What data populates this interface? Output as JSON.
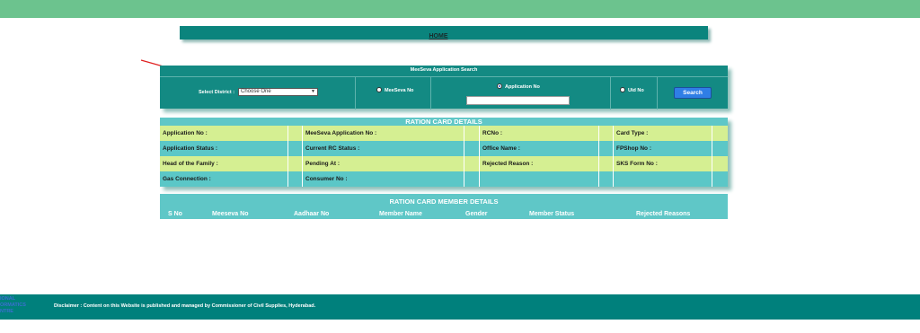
{
  "header": {
    "home_link": "HOME"
  },
  "search": {
    "title": "MeeSeva Application Search",
    "district_label": "Select District :",
    "district_selected": "Choose One",
    "options": [
      {
        "label": "MeeSeva No",
        "checked": false
      },
      {
        "label": "Application No",
        "checked": true
      },
      {
        "label": "Uid No",
        "checked": false
      }
    ],
    "search_button": "Search"
  },
  "ration_card": {
    "title": "RATION CARD DETAILS",
    "rows": [
      [
        "Application No :",
        "MeeSeva Application No :",
        "RCNo :",
        "Card Type :"
      ],
      [
        "Application Status :",
        "Current RC Status :",
        "Office Name :",
        "FPShop No :"
      ],
      [
        "Head of the Family :",
        "Pending At :",
        "Rejected Reason :",
        "SKS Form No :"
      ],
      [
        "Gas Connection :",
        "Consumer No :",
        "",
        ""
      ]
    ]
  },
  "members": {
    "title": "RATION CARD MEMBER DETAILS",
    "columns": [
      "S No",
      "Meeseva No",
      "Aadhaar No",
      "Member Name",
      "Gender",
      "Member Status",
      "Rejected Reasons"
    ]
  },
  "footer": {
    "logo_lines": [
      "IONAL",
      "ORMATICS",
      "NTRE"
    ],
    "disclaimer": "Disclaimer : Content on this Website is published and managed by Commissioner of Civil Supplies, Hyderabad."
  },
  "colors": {
    "accent": "#6cc38e",
    "teal_dark": "#0b847d",
    "teal_light": "#5fc7c7",
    "row_light": "#d5ef92",
    "button": "#2f7ee6"
  }
}
